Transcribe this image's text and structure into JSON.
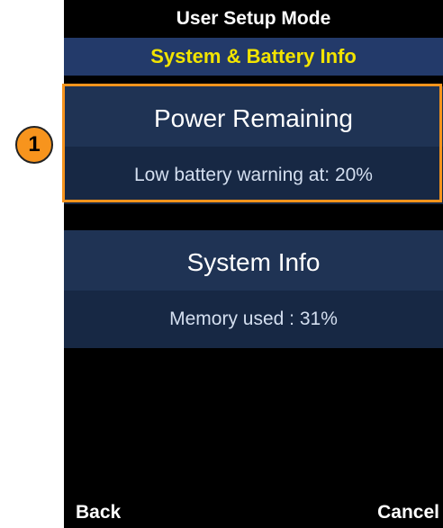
{
  "callout": {
    "number": "1"
  },
  "header": {
    "mode_title": "User Setup Mode",
    "screen_title": "System & Battery Info"
  },
  "power_section": {
    "title": "Power Remaining",
    "value": "Low battery warning at: 20%"
  },
  "system_section": {
    "title": "System Info",
    "value": "Memory used : 31%"
  },
  "softkeys": {
    "left": "Back",
    "right": "Cancel"
  },
  "colors": {
    "highlight": "#f7941d",
    "screen_title": "#f2e400",
    "section_bg": "#1f3354"
  }
}
